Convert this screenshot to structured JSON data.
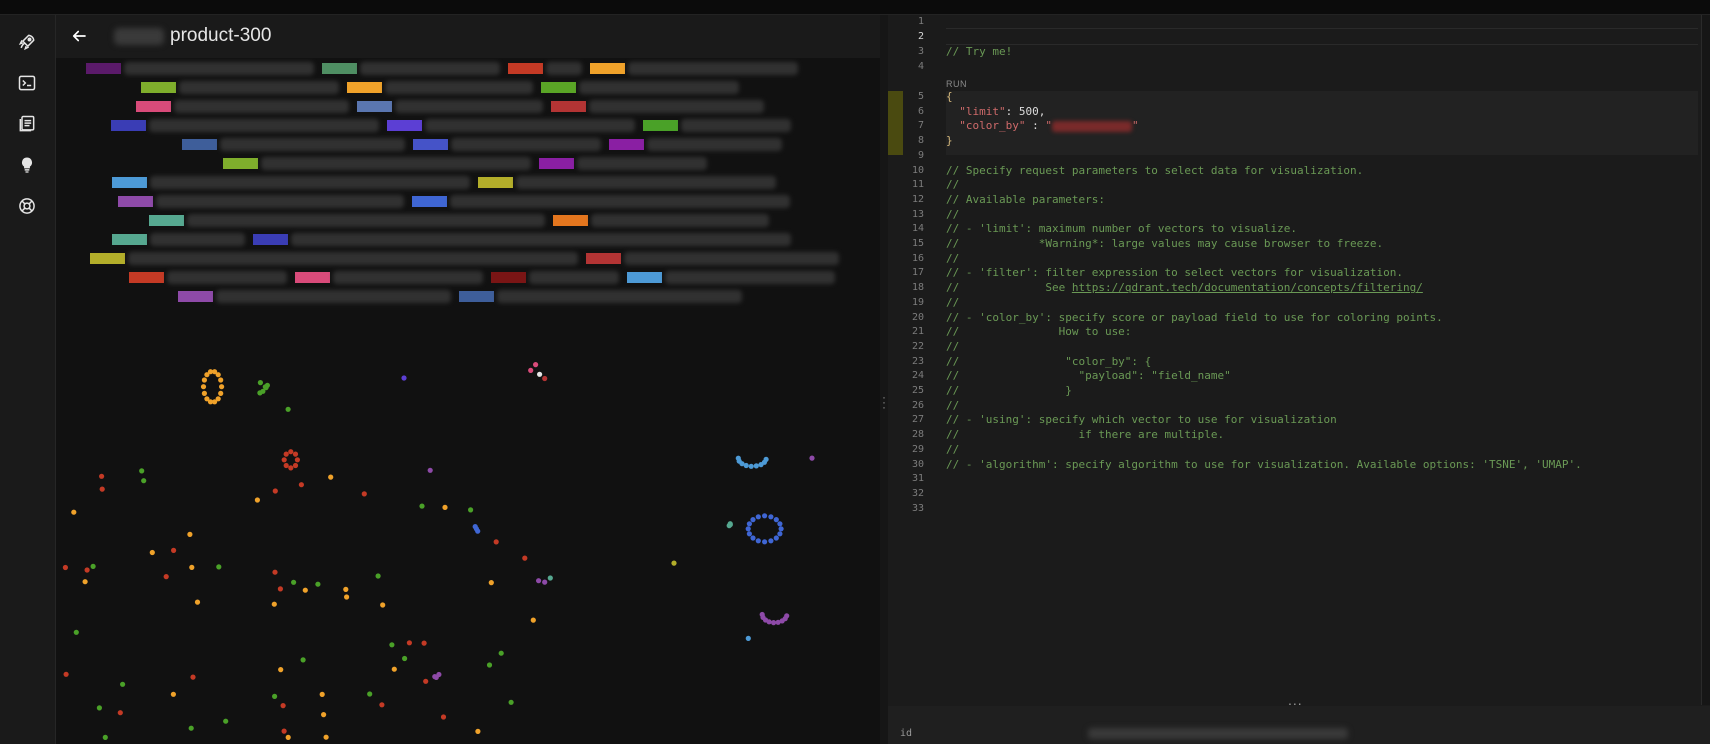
{
  "header": {
    "back_icon": "arrow-left-icon",
    "collection_name": "product-300"
  },
  "sidebar": {
    "items": [
      {
        "name": "rocket-icon"
      },
      {
        "name": "terminal-icon"
      },
      {
        "name": "collections-icon"
      },
      {
        "name": "lightbulb-icon"
      },
      {
        "name": "lifebuoy-icon"
      }
    ]
  },
  "legend": {
    "rows": [
      [
        [
          "#5b1a6a",
          190
        ],
        [
          "#4f8f63",
          140
        ],
        [
          "#c43a25",
          36
        ],
        [
          "#f0a22a",
          170
        ]
      ],
      [
        [
          "#7fae2c",
          160
        ],
        [
          "#f0a22a",
          148
        ],
        [
          "#5aa526",
          160
        ]
      ],
      [
        [
          "#d94b7a",
          175
        ],
        [
          "#5a76b0",
          148
        ],
        [
          "#b33434",
          175
        ]
      ],
      [
        [
          "#3a3db5",
          230
        ],
        [
          "#5c3fd4",
          210
        ],
        [
          "#4aa128",
          110
        ]
      ],
      [
        [
          "#3e5e9a",
          185
        ],
        [
          "#4553c8",
          150
        ],
        [
          "#8a1fa3",
          135
        ]
      ],
      [
        [
          "#7fae2c",
          270
        ],
        [
          "#8a1fa3",
          130
        ]
      ],
      [
        [
          "#4d9ad6",
          320
        ],
        [
          "#b3ae2a",
          260
        ]
      ],
      [
        [
          "#8e4aa8",
          248
        ],
        [
          "#3f66d4",
          340
        ]
      ],
      [
        [
          "#56a890",
          358
        ],
        [
          "#e4761e",
          178
        ]
      ],
      [
        [
          "#56a890",
          95
        ],
        [
          "#3a3db5",
          500
        ]
      ],
      [
        [
          "#b3ae2a",
          450
        ],
        [
          "#b33434",
          215
        ]
      ],
      [
        [
          "#c43a25",
          120
        ],
        [
          "#d94b7a",
          150
        ],
        [
          "#7a1515",
          90
        ],
        [
          "#4d9ad6",
          170
        ]
      ],
      [
        [
          "#8e4aa8",
          235
        ],
        [
          "#3e5e9a",
          245
        ]
      ]
    ]
  },
  "editor": {
    "line_count": 33,
    "current_line": 2,
    "run_label": "RUN",
    "lines": [
      {
        "n": 1,
        "text": ""
      },
      {
        "n": 2,
        "text": ""
      },
      {
        "n": 3,
        "text": "// Try me!",
        "cls": "c-comment"
      },
      {
        "n": 4,
        "text": ""
      },
      {
        "n": 5,
        "text": "{",
        "cls": "c-punct"
      },
      {
        "n": 6,
        "parts": [
          [
            "  \"limit\"",
            "c-key"
          ],
          [
            ": ",
            "c-num"
          ],
          [
            "500",
            "c-num"
          ],
          [
            ",",
            "c-num"
          ]
        ]
      },
      {
        "n": 7,
        "parts": [
          [
            "  \"color_by\"",
            "c-key"
          ],
          [
            " : ",
            "c-num"
          ],
          [
            "\"",
            "c-key"
          ],
          [
            "",
            "c-redact"
          ],
          [
            "\"",
            "c-key"
          ]
        ]
      },
      {
        "n": 8,
        "text": "}",
        "cls": "c-punct"
      },
      {
        "n": 9,
        "text": ""
      },
      {
        "n": 10,
        "text": "// Specify request parameters to select data for visualization.",
        "cls": "c-comment"
      },
      {
        "n": 11,
        "text": "//",
        "cls": "c-comment"
      },
      {
        "n": 12,
        "text": "// Available parameters:",
        "cls": "c-comment"
      },
      {
        "n": 13,
        "text": "//",
        "cls": "c-comment"
      },
      {
        "n": 14,
        "text": "// - 'limit': maximum number of vectors to visualize.",
        "cls": "c-comment"
      },
      {
        "n": 15,
        "text": "//            *Warning*: large values may cause browser to freeze.",
        "cls": "c-comment"
      },
      {
        "n": 16,
        "text": "//",
        "cls": "c-comment"
      },
      {
        "n": 17,
        "text": "// - 'filter': filter expression to select vectors for visualization.",
        "cls": "c-comment"
      },
      {
        "n": 18,
        "parts": [
          [
            "//             See ",
            "c-comment"
          ],
          [
            "https://qdrant.tech/documentation/concepts/filtering/",
            "c-link"
          ]
        ]
      },
      {
        "n": 19,
        "text": "//",
        "cls": "c-comment"
      },
      {
        "n": 20,
        "text": "// - 'color_by': specify score or payload field to use for coloring points.",
        "cls": "c-comment"
      },
      {
        "n": 21,
        "text": "//               How to use:",
        "cls": "c-comment"
      },
      {
        "n": 22,
        "text": "//",
        "cls": "c-comment"
      },
      {
        "n": 23,
        "text": "//                \"color_by\": {",
        "cls": "c-comment"
      },
      {
        "n": 24,
        "text": "//                  \"payload\": \"field_name\"",
        "cls": "c-comment"
      },
      {
        "n": 25,
        "text": "//                }",
        "cls": "c-comment"
      },
      {
        "n": 26,
        "text": "//",
        "cls": "c-comment"
      },
      {
        "n": 27,
        "text": "// - 'using': specify which vector to use for visualization",
        "cls": "c-comment"
      },
      {
        "n": 28,
        "text": "//                  if there are multiple.",
        "cls": "c-comment"
      },
      {
        "n": 29,
        "text": "//",
        "cls": "c-comment"
      },
      {
        "n": 30,
        "text": "// - 'algorithm': specify algorithm to use for visualization. Available options: 'TSNE', 'UMAP'.",
        "cls": "c-comment"
      },
      {
        "n": 31,
        "text": ""
      },
      {
        "n": 32,
        "text": ""
      },
      {
        "n": 33,
        "text": ""
      }
    ]
  },
  "result": {
    "dots": "...",
    "label": "id"
  },
  "chart_data": {
    "type": "scatter",
    "clusters": [
      {
        "color": "#f0a22a",
        "shape": "ring",
        "cx": 0.19,
        "cy": 0.12,
        "rx": 0.011,
        "ry": 0.038,
        "n": 14
      },
      {
        "color": "#4aa128",
        "shape": "blob",
        "cx": 0.255,
        "cy": 0.12,
        "rx": 0.009,
        "ry": 0.02,
        "n": 6
      },
      {
        "color": "#c43a25",
        "shape": "ring",
        "cx": 0.285,
        "cy": 0.3,
        "rx": 0.008,
        "ry": 0.02,
        "n": 8
      },
      {
        "color": "#4d9ad6",
        "shape": "arc",
        "cx": 0.845,
        "cy": 0.3,
        "rx": 0.017,
        "ry": 0.02,
        "n": 9
      },
      {
        "color": "#3f66d4",
        "shape": "ring",
        "cx": 0.86,
        "cy": 0.47,
        "rx": 0.02,
        "ry": 0.032,
        "n": 16
      },
      {
        "color": "#8e4aa8",
        "shape": "arc",
        "cx": 0.872,
        "cy": 0.685,
        "rx": 0.015,
        "ry": 0.02,
        "n": 9
      },
      {
        "color": "#56a890",
        "shape": "blob",
        "cx": 0.817,
        "cy": 0.47,
        "rx": 0.004,
        "ry": 0.015,
        "n": 3
      },
      {
        "color": "#3f66d4",
        "shape": "blob",
        "cx": 0.51,
        "cy": 0.47,
        "rx": 0.002,
        "ry": 0.006,
        "n": 3
      },
      {
        "color": "#8e4aa8",
        "shape": "blob",
        "cx": 0.462,
        "cy": 0.835,
        "rx": 0.003,
        "ry": 0.01,
        "n": 3
      },
      {
        "color": "#d94b7a",
        "shape": "blob",
        "cx": 0.58,
        "cy": 0.07,
        "rx": 0.006,
        "ry": 0.01,
        "n": 2
      },
      {
        "color": "#e8e8e8",
        "shape": "blob",
        "cx": 0.587,
        "cy": 0.09,
        "rx": 0.001,
        "ry": 0.001,
        "n": 1
      },
      {
        "color": "#b33434",
        "shape": "blob",
        "cx": 0.593,
        "cy": 0.1,
        "rx": 0.001,
        "ry": 0.001,
        "n": 1
      },
      {
        "color": "#5c3fd4",
        "shape": "blob",
        "cx": 0.423,
        "cy": 0.098,
        "rx": 0.001,
        "ry": 0.001,
        "n": 1
      },
      {
        "color": "#4aa128",
        "shape": "blob",
        "cx": 0.282,
        "cy": 0.176,
        "rx": 0.001,
        "ry": 0.001,
        "n": 1
      },
      {
        "color": "#8e4aa8",
        "shape": "blob",
        "cx": 0.455,
        "cy": 0.325,
        "rx": 0.001,
        "ry": 0.001,
        "n": 1
      },
      {
        "color": "#8e4aa8",
        "shape": "blob",
        "cx": 0.918,
        "cy": 0.295,
        "rx": 0.001,
        "ry": 0.001,
        "n": 1
      },
      {
        "color": "#b3ae2a",
        "shape": "blob",
        "cx": 0.75,
        "cy": 0.555,
        "rx": 0.001,
        "ry": 0.001,
        "n": 1
      },
      {
        "color": "#4d9ad6",
        "shape": "blob",
        "cx": 0.84,
        "cy": 0.74,
        "rx": 0.001,
        "ry": 0.001,
        "n": 1
      },
      {
        "color": "#8e4aa8",
        "shape": "blob",
        "cx": 0.59,
        "cy": 0.6,
        "rx": 0.006,
        "ry": 0.004,
        "n": 2
      },
      {
        "color": "#56a890",
        "shape": "blob",
        "cx": 0.6,
        "cy": 0.592,
        "rx": 0.001,
        "ry": 0.001,
        "n": 1
      }
    ],
    "scatter_colors": [
      "#f0a22a",
      "#4aa128",
      "#c43a25"
    ],
    "scatter_region": {
      "x0": 0.0,
      "x1": 0.6,
      "y0": 0.33,
      "y1": 1.0
    },
    "scatter_count": 70
  }
}
